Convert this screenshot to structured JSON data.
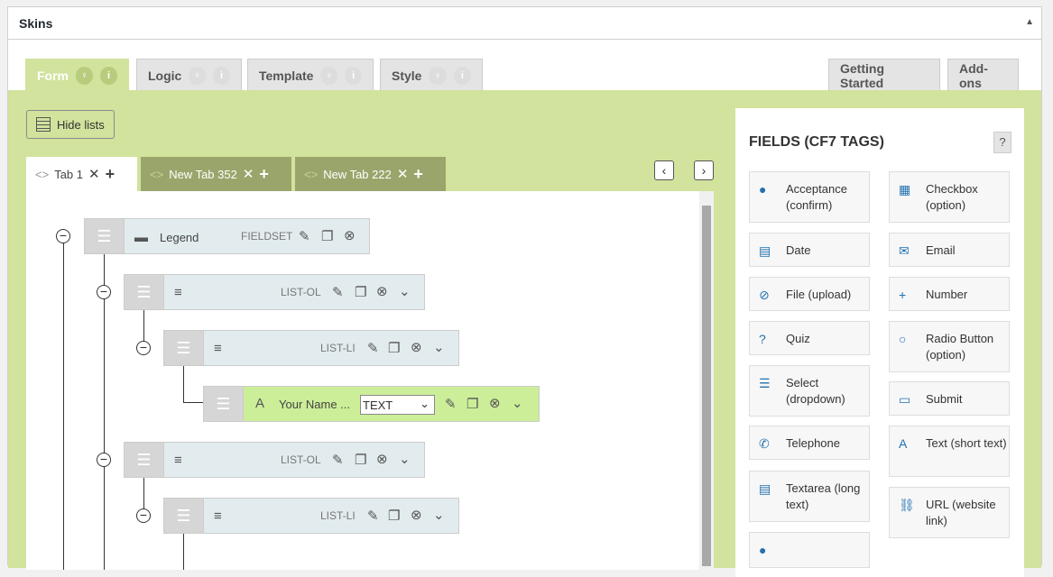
{
  "panel": {
    "title": "Skins"
  },
  "tabs": [
    {
      "label": "Form"
    },
    {
      "label": "Logic"
    },
    {
      "label": "Template"
    },
    {
      "label": "Style"
    },
    {
      "label": "Getting Started"
    },
    {
      "label": "Add-ons"
    }
  ],
  "toolbar": {
    "hide_lists": "Hide lists"
  },
  "form_tabs": [
    {
      "label": "Tab 1"
    },
    {
      "label": "New Tab 352"
    },
    {
      "label": "New Tab 222"
    }
  ],
  "tree": {
    "fieldset_label": "Legend",
    "fieldset_type": "FIELDSET",
    "list_ol": "LIST-OL",
    "list_li": "LIST-LI",
    "field_label": "Your Name ...",
    "field_type": "TEXT"
  },
  "fields": {
    "title": "FIELDS (CF7 TAGS)",
    "help": "?",
    "items": [
      {
        "label": "Acceptance (confirm)"
      },
      {
        "label": "Checkbox (option)"
      },
      {
        "label": "Date"
      },
      {
        "label": "Email"
      },
      {
        "label": "File (upload)"
      },
      {
        "label": "Number"
      },
      {
        "label": "Quiz"
      },
      {
        "label": "Radio Button (option)"
      },
      {
        "label": "Select (dropdown)"
      },
      {
        "label": "Submit"
      },
      {
        "label": "Telephone"
      },
      {
        "label": "Text (short text)"
      },
      {
        "label": "Textarea (long text)"
      },
      {
        "label": "URL (website link)"
      }
    ]
  }
}
